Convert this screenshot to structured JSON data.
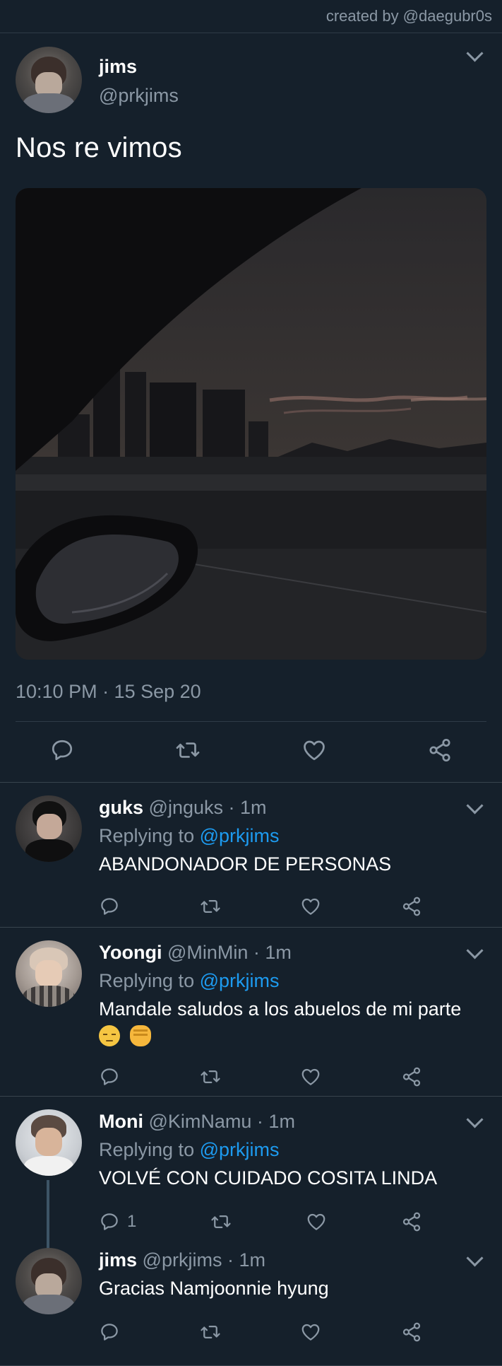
{
  "credit": "created by @daegubr0s",
  "main_tweet": {
    "name": "jims",
    "handle": "@prkjims",
    "text": "Nos re vimos",
    "timestamp": "10:10 PM · 15 Sep 20"
  },
  "replies": [
    {
      "name": "guks",
      "meta": "@jnguks · 1m",
      "replying_prefix": "Replying to ",
      "replying_handle": "@prkjims",
      "text": "ABANDONADOR DE PERSONAS",
      "reply_count": ""
    },
    {
      "name": "Yoongi",
      "meta": "@MinMin · 1m",
      "replying_prefix": "Replying to ",
      "replying_handle": "@prkjims",
      "text": "Mandale saludos a los abuelos de mi parte",
      "emojis": [
        "pensive-face",
        "raised-fist"
      ],
      "reply_count": ""
    },
    {
      "name": "Moni",
      "meta": "@KimNamu · 1m",
      "replying_prefix": "Replying to ",
      "replying_handle": "@prkjims",
      "text": "VOLVÉ CON CUIDADO COSITA LINDA",
      "reply_count": "1"
    },
    {
      "name": "jims",
      "meta": "@prkjims · 1m",
      "text": "Gracias Namjoonnie hyung",
      "reply_count": ""
    }
  ],
  "icons": [
    "reply-icon",
    "retweet-icon",
    "like-icon",
    "share-icon",
    "chevron-down-icon"
  ],
  "colors": {
    "background": "#15202b",
    "secondary_text": "#8b98a5",
    "accent": "#1d9bf0",
    "divider": "#38444d"
  }
}
